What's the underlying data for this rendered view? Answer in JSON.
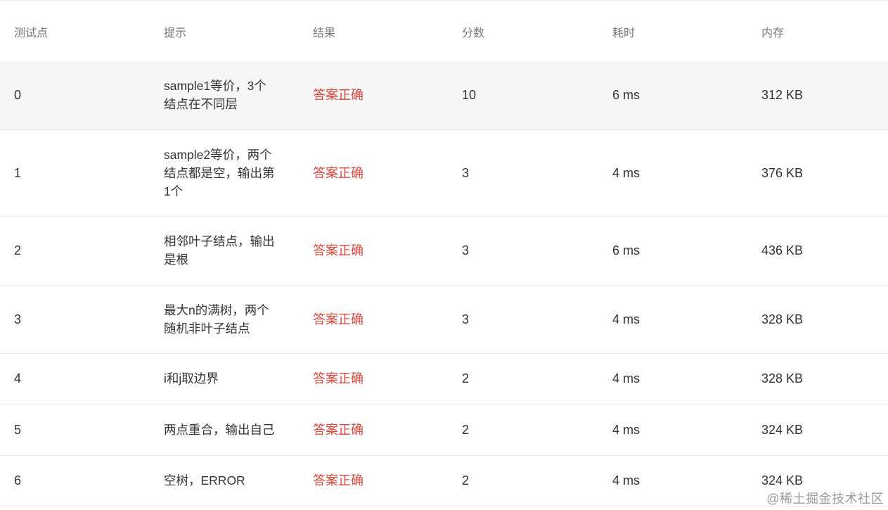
{
  "table": {
    "headers": [
      "测试点",
      "提示",
      "结果",
      "分数",
      "耗时",
      "内存"
    ],
    "rows": [
      {
        "id": "0",
        "hint": "sample1等价，3个结点在不同层",
        "result": "答案正确",
        "score": "10",
        "time": "6 ms",
        "memory": "312 KB"
      },
      {
        "id": "1",
        "hint": "sample2等价，两个结点都是空，输出第1个",
        "result": "答案正确",
        "score": "3",
        "time": "4 ms",
        "memory": "376 KB"
      },
      {
        "id": "2",
        "hint": "相邻叶子结点，输出是根",
        "result": "答案正确",
        "score": "3",
        "time": "6 ms",
        "memory": "436 KB"
      },
      {
        "id": "3",
        "hint": "最大n的满树，两个随机非叶子结点",
        "result": "答案正确",
        "score": "3",
        "time": "4 ms",
        "memory": "328 KB"
      },
      {
        "id": "4",
        "hint": "i和j取边界",
        "result": "答案正确",
        "score": "2",
        "time": "4 ms",
        "memory": "328 KB"
      },
      {
        "id": "5",
        "hint": "两点重合，输出自己",
        "result": "答案正确",
        "score": "2",
        "time": "4 ms",
        "memory": "324 KB"
      },
      {
        "id": "6",
        "hint": "空树，ERROR",
        "result": "答案正确",
        "score": "2",
        "time": "4 ms",
        "memory": "324 KB"
      }
    ]
  },
  "watermark": "@稀土掘金技术社区",
  "colors": {
    "accepted": "#e0453a",
    "header_text": "#777777",
    "body_text": "#333333",
    "highlight_row": "#f7f7f7",
    "divider": "#ebebeb"
  }
}
